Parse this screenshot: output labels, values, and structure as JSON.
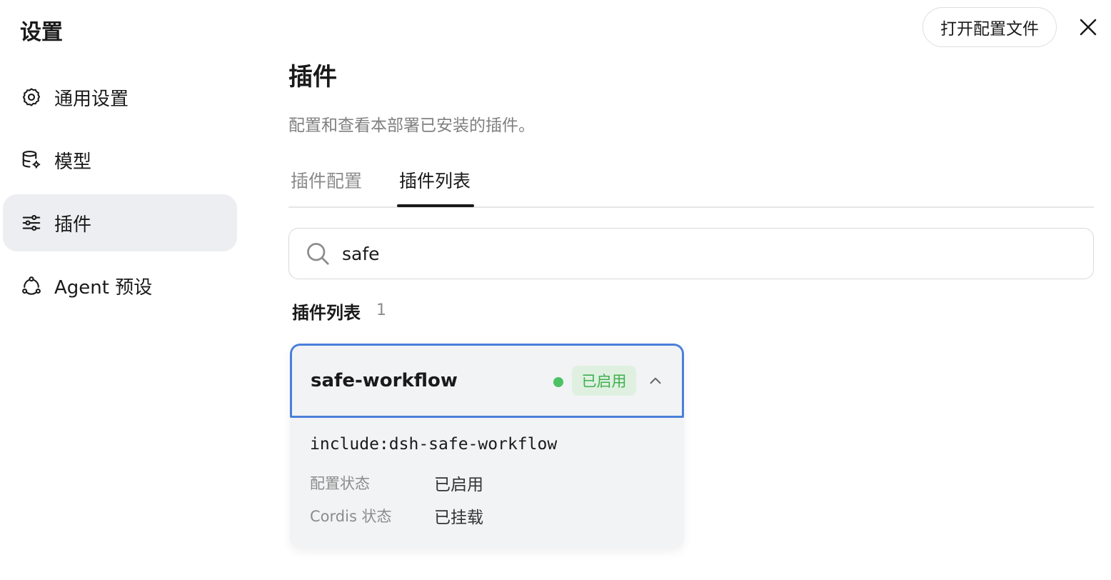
{
  "app": {
    "title": "设置"
  },
  "sidebar": {
    "items": [
      {
        "label": "通用设置",
        "icon": "gear-icon",
        "active": false
      },
      {
        "label": "模型",
        "icon": "database-gear-icon",
        "active": false
      },
      {
        "label": "插件",
        "icon": "sliders-icon",
        "active": true
      },
      {
        "label": "Agent 预设",
        "icon": "agent-network-icon",
        "active": false
      }
    ]
  },
  "header": {
    "open_config_label": "打开配置文件",
    "close_icon": "close-icon"
  },
  "page": {
    "title": "插件",
    "description": "配置和查看本部署已安装的插件。"
  },
  "tabs": [
    {
      "label": "插件配置",
      "active": false
    },
    {
      "label": "插件列表",
      "active": true
    }
  ],
  "search": {
    "value": "safe",
    "icon": "search-icon"
  },
  "plugin_list": {
    "heading": "插件列表",
    "count": "1",
    "items": [
      {
        "name": "safe-workflow",
        "status_label": "已启用",
        "status_color": "#4cc264",
        "include": "include:dsh-safe-workflow",
        "details": [
          {
            "key": "配置状态",
            "value": "已启用"
          },
          {
            "key": "Cordis 状态",
            "value": "已挂载"
          }
        ]
      }
    ]
  },
  "colors": {
    "accent_border": "#4a7fd9",
    "active_nav_bg": "#edeef1",
    "status_green": "#4cc264"
  }
}
